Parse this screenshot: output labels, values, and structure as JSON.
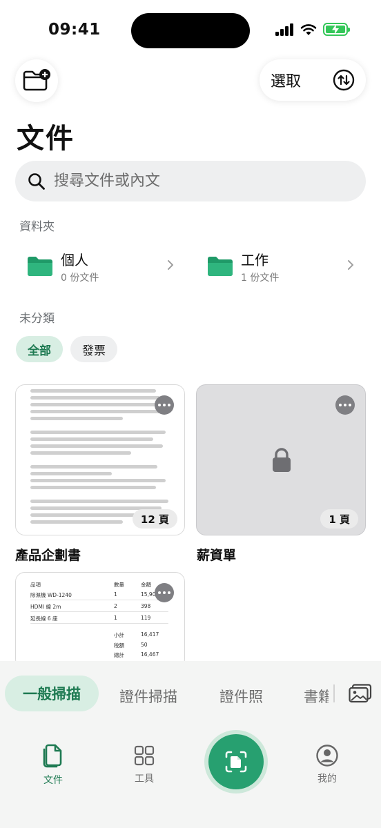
{
  "status": {
    "time": "09:41"
  },
  "header": {
    "select_label": "選取"
  },
  "page": {
    "title": "文件"
  },
  "search": {
    "placeholder": "搜尋文件或內文"
  },
  "folders": {
    "section_label": "資料夾",
    "items": [
      {
        "name": "個人",
        "count": "0 份文件"
      },
      {
        "name": "工作",
        "count": "1 份文件"
      }
    ]
  },
  "uncategorized": {
    "section_label": "未分類",
    "chips": [
      {
        "label": "全部",
        "active": true
      },
      {
        "label": "發票",
        "active": false
      }
    ]
  },
  "documents": [
    {
      "title": "產品企劃書",
      "pages": "12 頁",
      "locked": false
    },
    {
      "title": "薪資單",
      "pages": "1 頁",
      "locked": true
    },
    {
      "title": "",
      "preview": {
        "headers": [
          "品項",
          "數量",
          "金額"
        ],
        "rows": [
          [
            "除濕機 WD-1240",
            "1",
            "15,900"
          ],
          [
            "HDMI 線 2m",
            "2",
            "398"
          ],
          [
            "延長線 6 座",
            "1",
            "119"
          ]
        ],
        "totals": [
          [
            "小計",
            "16,417"
          ],
          [
            "稅額",
            "50"
          ],
          [
            "總計",
            "16,467"
          ]
        ]
      }
    }
  ],
  "scan_modes": [
    {
      "label": "一般掃描",
      "active": true
    },
    {
      "label": "證件掃描",
      "active": false
    },
    {
      "label": "證件照",
      "active": false
    },
    {
      "label": "書籍",
      "active": false
    }
  ],
  "nav": {
    "items": [
      {
        "label": "文件",
        "active": true
      },
      {
        "label": "工具",
        "active": false
      },
      {
        "label": "我的",
        "active": false
      }
    ]
  },
  "colors": {
    "accent": "#27a070",
    "accent_dark": "#1e7a52",
    "accent_light": "#d8eee3"
  }
}
